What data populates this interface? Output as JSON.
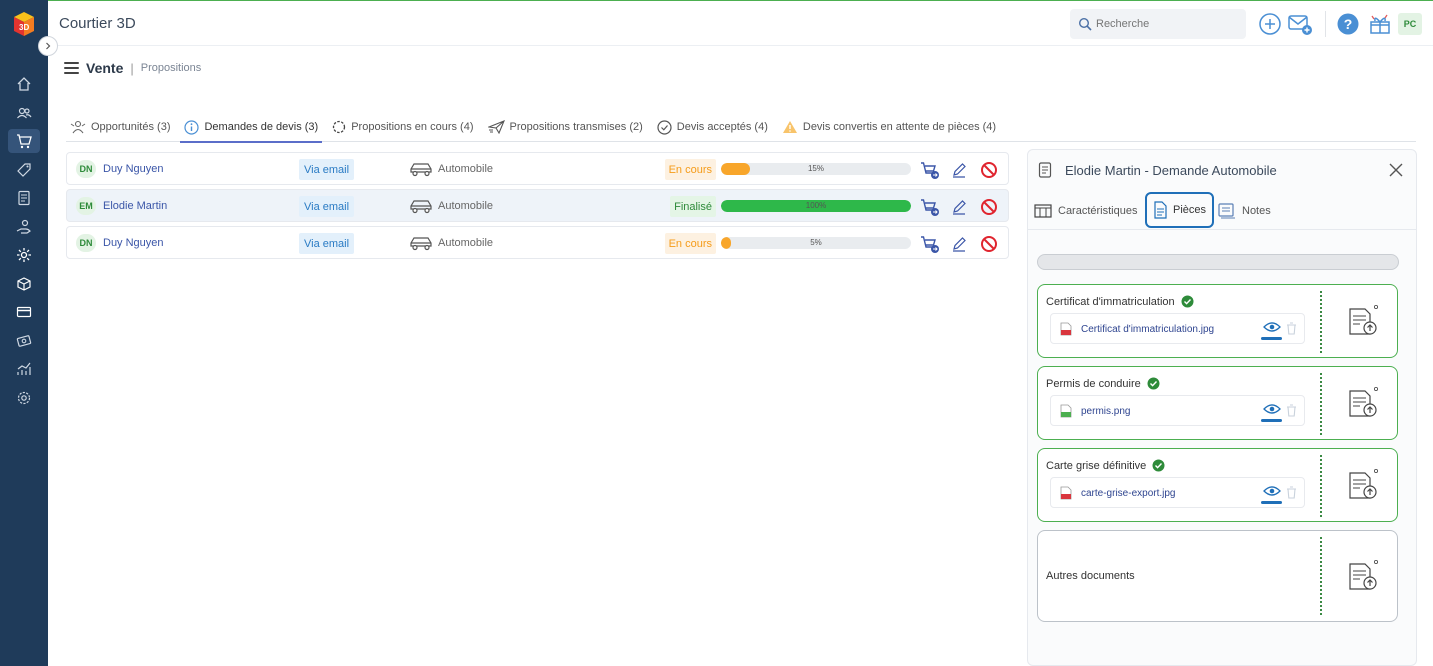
{
  "app": {
    "title": "Courtier 3D"
  },
  "search": {
    "placeholder": "Recherche"
  },
  "user": {
    "initials": "PC"
  },
  "breadcrumb": {
    "main": "Vente",
    "sub": "Propositions"
  },
  "tabs": [
    {
      "label": "Opportunités (3)",
      "icon": "people-icon"
    },
    {
      "label": "Demandes de devis (3)",
      "icon": "info-icon"
    },
    {
      "label": "Propositions en cours (4)",
      "icon": "spinner-icon"
    },
    {
      "label": "Propositions transmises (2)",
      "icon": "paper-plane-icon"
    },
    {
      "label": "Devis acceptés (4)",
      "icon": "check-circle-icon"
    },
    {
      "label": "Devis convertis en attente de pièces (4)",
      "icon": "warning-icon"
    }
  ],
  "rows": [
    {
      "initials": "DN",
      "name": "Duy Nguyen",
      "channel": "Via email",
      "vehicle": "Automobile",
      "status": "En cours",
      "progress": 15,
      "progress_label": "15%"
    },
    {
      "initials": "EM",
      "name": "Elodie Martin",
      "channel": "Via email",
      "vehicle": "Automobile",
      "status": "Finalisé",
      "progress": 100,
      "progress_label": "100%"
    },
    {
      "initials": "DN",
      "name": "Duy Nguyen",
      "channel": "Via email",
      "vehicle": "Automobile",
      "status": "En cours",
      "progress": 5,
      "progress_label": "5%"
    }
  ],
  "panel": {
    "title": "Elodie Martin - Demande Automobile",
    "tabs": [
      "Caractéristiques",
      "Pièces",
      "Notes"
    ],
    "documents": [
      {
        "title": "Certificat d'immatriculation",
        "file": "Certificat d'immatriculation.jpg"
      },
      {
        "title": "Permis de conduire",
        "file": "permis.png"
      },
      {
        "title": "Carte grise définitive",
        "file": "carte-grise-export.jpg"
      }
    ],
    "others": {
      "title": "Autres documents"
    }
  },
  "colors": {
    "sidebar": "#1f3b5a",
    "accent": "#1f6fb8",
    "green": "#2eb84a",
    "orange": "#f8a62b"
  }
}
